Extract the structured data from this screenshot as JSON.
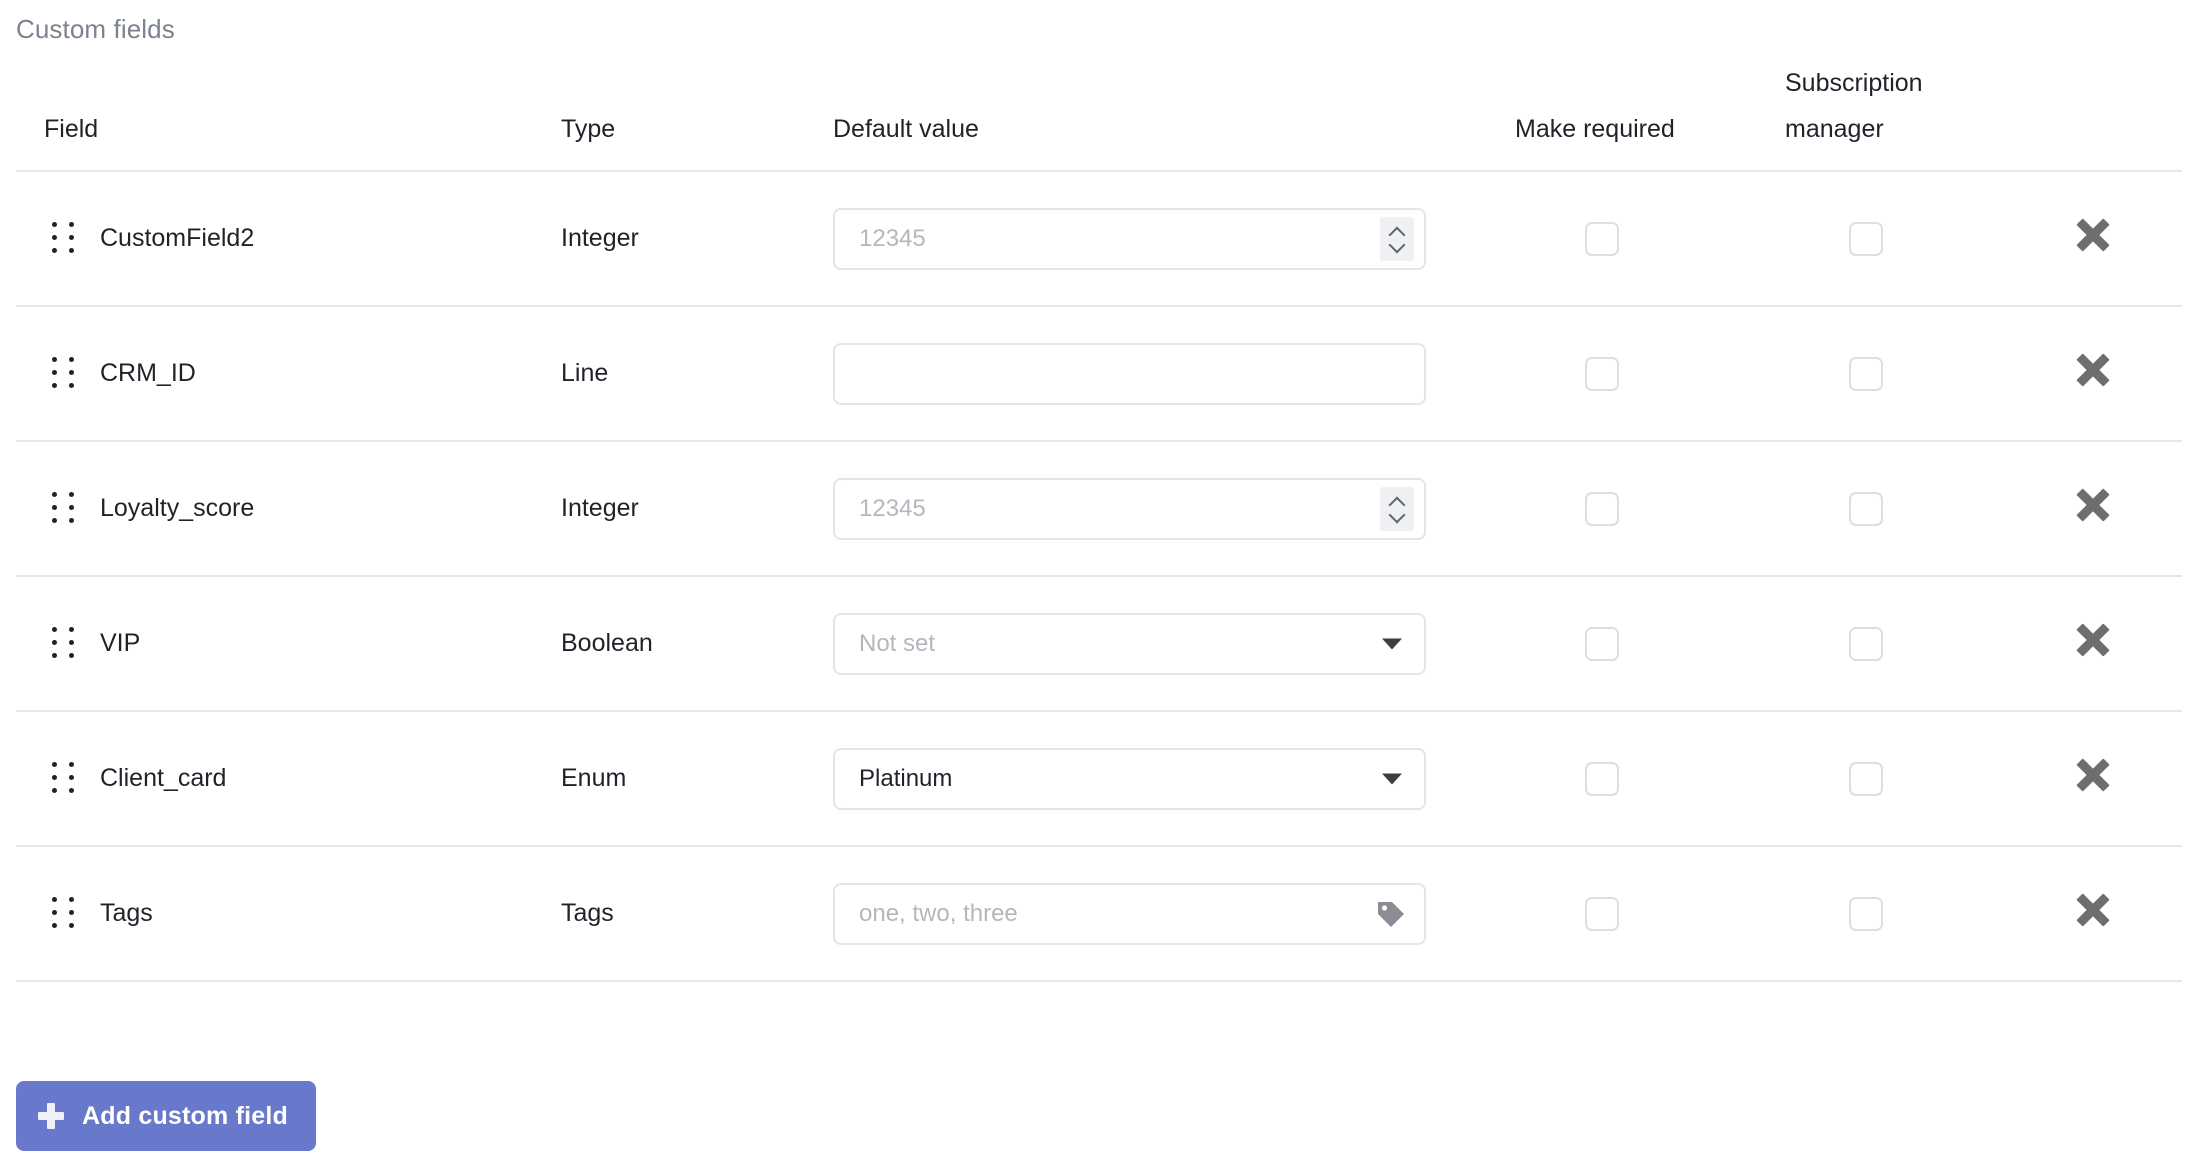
{
  "section": {
    "title": "Custom fields"
  },
  "table": {
    "headers": {
      "field": "Field",
      "type": "Type",
      "default_value": "Default value",
      "make_required": "Make required",
      "subscription_manager_line1": "Subscription",
      "subscription_manager_line2": "manager"
    },
    "rows": [
      {
        "field": "CustomField2",
        "type": "Integer",
        "control": "number",
        "value": "",
        "placeholder": "12345",
        "make_required": false,
        "subscription_manager": false
      },
      {
        "field": "CRM_ID",
        "type": "Line",
        "control": "text",
        "value": "",
        "placeholder": "",
        "make_required": false,
        "subscription_manager": false
      },
      {
        "field": "Loyalty_score",
        "type": "Integer",
        "control": "number",
        "value": "",
        "placeholder": "12345",
        "make_required": false,
        "subscription_manager": false
      },
      {
        "field": "VIP",
        "type": "Boolean",
        "control": "select",
        "value": "",
        "placeholder": "Not set",
        "make_required": false,
        "subscription_manager": false
      },
      {
        "field": "Client_card",
        "type": "Enum",
        "control": "select",
        "value": "Platinum",
        "placeholder": "",
        "make_required": false,
        "subscription_manager": false
      },
      {
        "field": "Tags",
        "type": "Tags",
        "control": "tags",
        "value": "",
        "placeholder": "one, two, three",
        "make_required": false,
        "subscription_manager": false
      }
    ]
  },
  "actions": {
    "add_custom_field": "Add custom field"
  },
  "icons": {
    "drag_handle": "drag-handle-icon",
    "delete": "close-icon",
    "spinner": "number-spinner-icon",
    "caret": "chevron-down-icon",
    "tag": "tag-icon",
    "plus": "plus-icon"
  },
  "colors": {
    "accent": "#6878ca",
    "title_text": "#7b838f",
    "body_text": "#1f2329",
    "placeholder_text": "#b4b7bd",
    "border": "#e4e5e7",
    "row_divider": "#e7e7e9",
    "delete_icon": "#6e6e6e"
  }
}
